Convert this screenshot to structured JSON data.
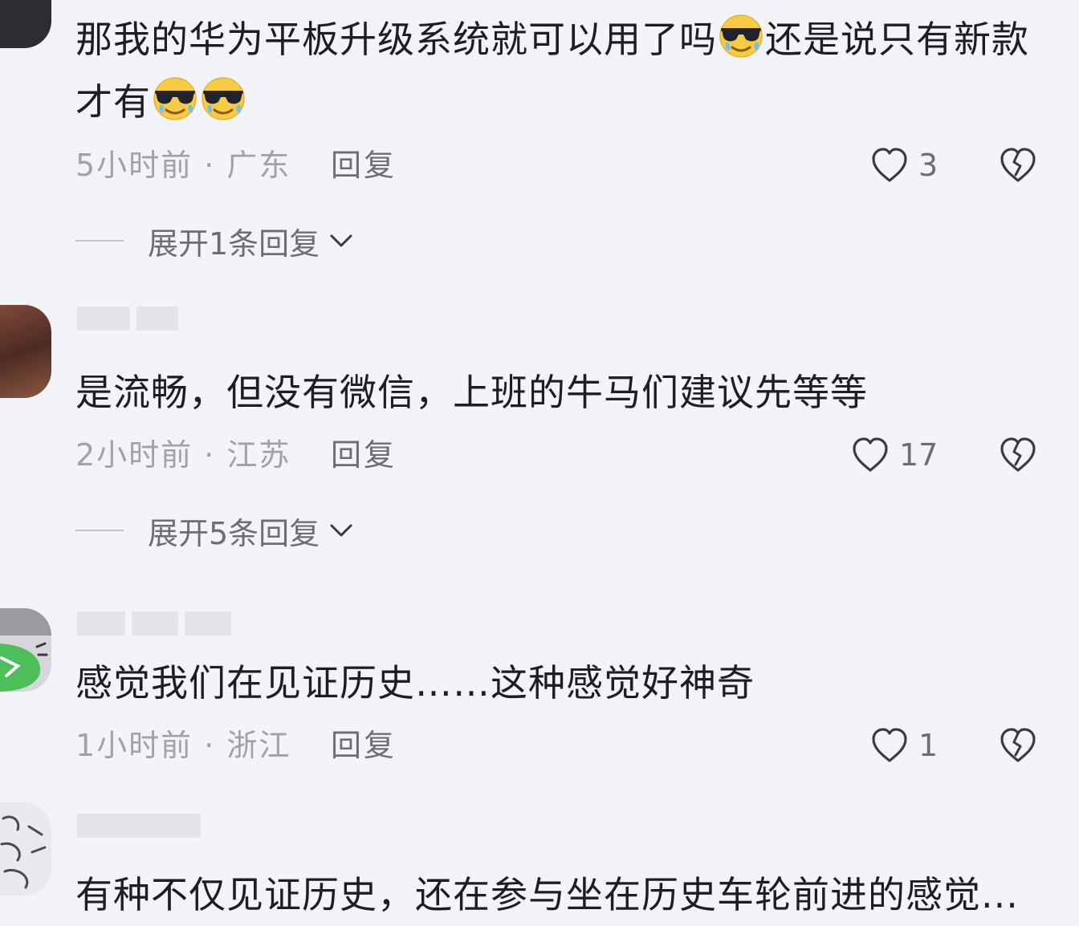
{
  "comments": [
    {
      "text_a": "那我的华为平板升级系统就可以用了吗",
      "text_b": "还是说只有新款才有",
      "emoji_a": "cool-sunglasses-emoji",
      "time_location": "5小时前 · 广东",
      "reply_label": "回复",
      "likes": "3",
      "expand_label": "展开1条回复"
    },
    {
      "text": "是流畅，但没有微信，上班的牛马们建议先等等",
      "time_location": "2小时前 · 江苏",
      "reply_label": "回复",
      "likes": "17",
      "expand_label": "展开5条回复"
    },
    {
      "text": "感觉我们在见证历史……这种感觉好神奇",
      "time_location": "1小时前 · 浙江",
      "reply_label": "回复",
      "likes": "1"
    },
    {
      "text": "有种不仅见证历史，还在参与坐在历史车轮前进的感觉..."
    }
  ],
  "icons": {
    "like": "heart-outline-icon",
    "dislike": "broken-heart-outline-icon",
    "expand": "chevron-down-icon"
  },
  "colors": {
    "background": "#f3f4f8",
    "text": "#1e1e22",
    "meta": "#a1a2a8",
    "secondary": "#6d6e74"
  }
}
